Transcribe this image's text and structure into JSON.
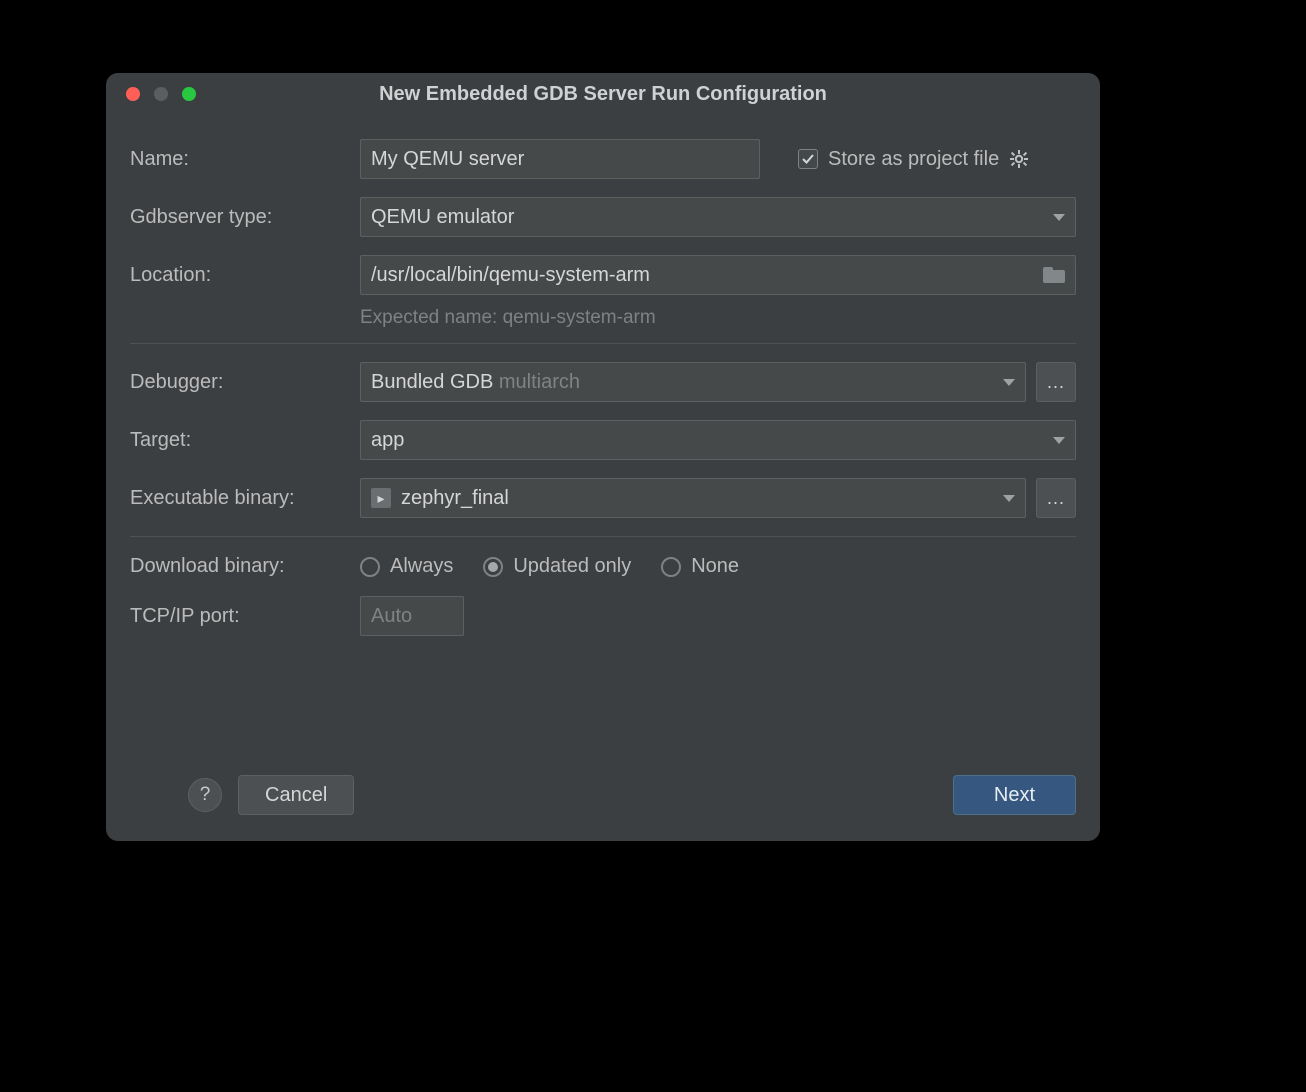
{
  "dialog": {
    "title": "New Embedded GDB Server Run Configuration",
    "labels": {
      "name": "Name:",
      "store": "Store as project file",
      "gdbserver_type": "Gdbserver type:",
      "location": "Location:",
      "expected_hint": "Expected name: qemu-system-arm",
      "debugger": "Debugger:",
      "target": "Target:",
      "executable": "Executable binary:",
      "download": "Download binary:",
      "tcp_port": "TCP/IP port:"
    },
    "values": {
      "name": "My QEMU server",
      "store_checked": true,
      "gdbserver_type": "QEMU emulator",
      "location": "/usr/local/bin/qemu-system-arm",
      "debugger_primary": "Bundled GDB",
      "debugger_secondary": "multiarch",
      "target": "app",
      "executable": "zephyr_final",
      "download_options": [
        "Always",
        "Updated only",
        "None"
      ],
      "download_selected_index": 1,
      "tcp_port_placeholder": "Auto",
      "tcp_port_value": ""
    },
    "footer": {
      "help": "?",
      "cancel": "Cancel",
      "next": "Next"
    },
    "more": "..."
  }
}
